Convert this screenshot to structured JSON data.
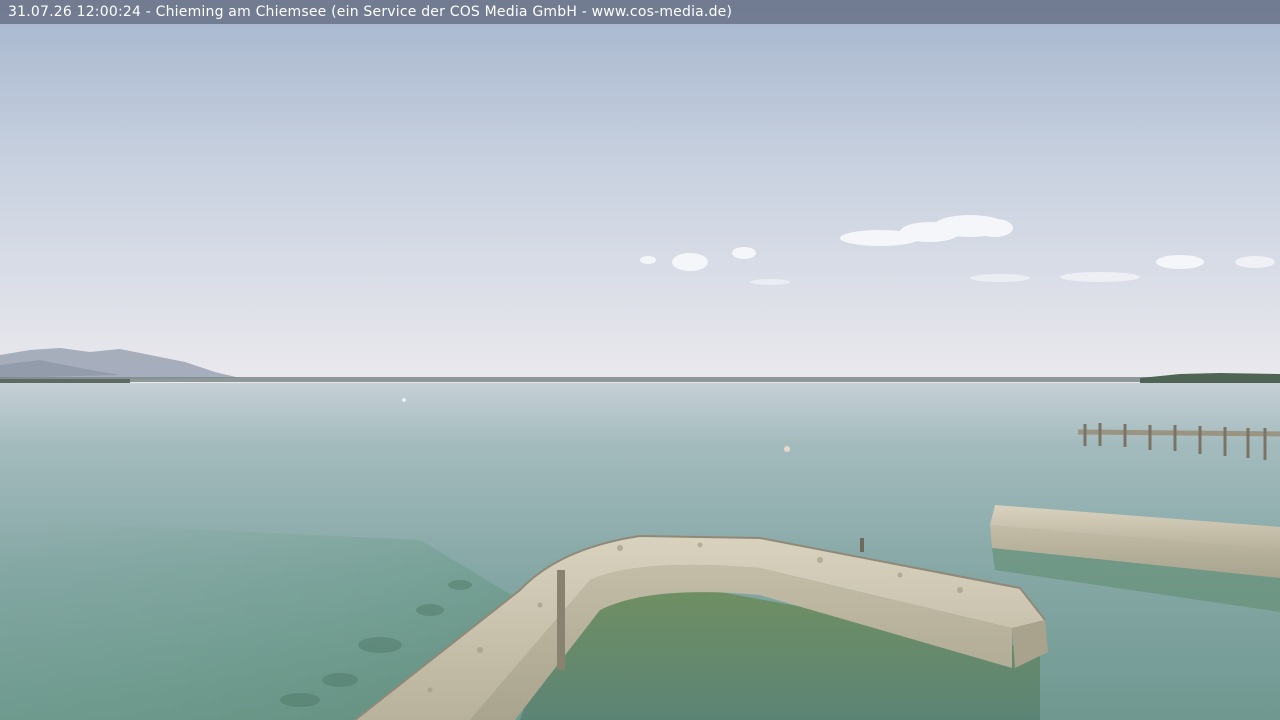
{
  "overlay": {
    "caption": "31.07.26 12:00:24 - Chieming am Chiemsee (ein Service der COS Media GmbH - www.cos-media.de)",
    "bar_color": "#6e768c",
    "text_color": "#ffffff"
  },
  "scene": {
    "description_kind": "webcam-photo",
    "sky_top_color": "#a9b8cf",
    "sky_horizon_color": "#e9e8ee",
    "water_color": "#7fa4a0",
    "wall_color": "#c9c3b1"
  }
}
